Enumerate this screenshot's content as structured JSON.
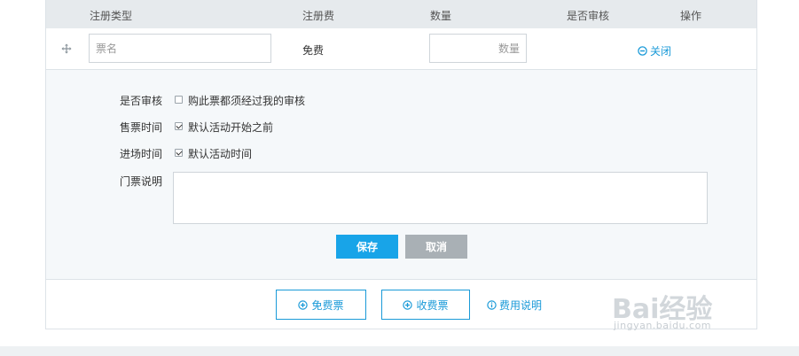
{
  "table": {
    "headers": [
      "注册类型",
      "注册费",
      "数量",
      "是否审核",
      "操作"
    ]
  },
  "ticket_row": {
    "name_placeholder": "票名",
    "fee_text": "免费",
    "quantity_placeholder": "数量",
    "close_label": "关闭"
  },
  "detail": {
    "review_label": "是否审核",
    "review_option": "购此票都须经过我的审核",
    "review_checked": false,
    "sale_time_label": "售票时间",
    "sale_time_option": "默认活动开始之前",
    "sale_time_checked": true,
    "entry_time_label": "进场时间",
    "entry_time_option": "默认活动时间",
    "entry_time_checked": true,
    "description_label": "门票说明",
    "save_label": "保存",
    "cancel_label": "取消"
  },
  "footer": {
    "free_ticket_label": "免费票",
    "paid_ticket_label": "收费票",
    "fee_info_label": "费用说明"
  },
  "watermark": {
    "main": "Bai经验",
    "sub": "jingyan.baidu.com"
  },
  "colors": {
    "accent": "#1a9ad8",
    "save": "#18a4e8",
    "cancel": "#a9b0b5",
    "header_bg": "#e6eaed",
    "detail_bg": "#f5f8fa"
  }
}
